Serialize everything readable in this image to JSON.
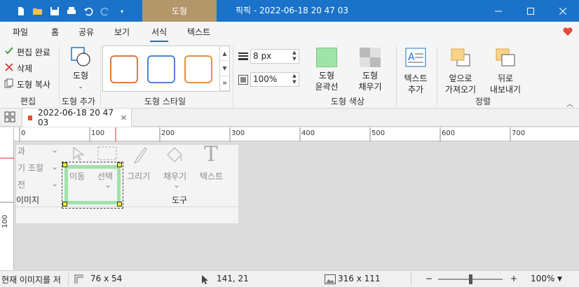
{
  "titlebar": {
    "context_tab": "도형",
    "title": "픽픽 - 2022-06-18 20 47 03",
    "accent": "#1a73c9"
  },
  "ribbon_tabs": [
    "파일",
    "홈",
    "공유",
    "보기",
    "서식",
    "텍스트"
  ],
  "active_tab": "서식",
  "edit_group": {
    "done": "편집 완료",
    "delete": "삭제",
    "copy_shape": "도형 복사",
    "label": "편집"
  },
  "shape_add": {
    "button": "도형",
    "label": "도형 추가"
  },
  "shape_style": {
    "label": "도형 스타일",
    "colors": [
      "#e07a3c",
      "#4a86d0",
      "#e8913c"
    ]
  },
  "line_props": {
    "width": "8 px",
    "opacity": "100%"
  },
  "shape_color": {
    "outline_l1": "도형",
    "outline_l2": "윤곽선",
    "fill_l1": "도형",
    "fill_l2": "채우기",
    "label": "도형 색상",
    "outline_color": "#9ee3a8"
  },
  "text_add": {
    "l1": "텍스트",
    "l2": "추가"
  },
  "arrange": {
    "front_l1": "앞으로",
    "front_l2": "가져오기",
    "back_l1": "뒤로",
    "back_l2": "내보내기",
    "label": "정렬"
  },
  "document_tab": {
    "name": "2022-06-18 20 47 03"
  },
  "ruler": {
    "h_ticks": [
      "0",
      "100",
      "200",
      "300",
      "400",
      "500",
      "600",
      "700"
    ],
    "v_ticks": [
      "100"
    ]
  },
  "image_content": {
    "line1": "과",
    "line2": "기 조절",
    "line3": "전",
    "label_image": "이미지",
    "move": "이동",
    "select": "선택",
    "draw": "그리기",
    "fill": "채우기",
    "text": "텍스트",
    "tools": "도구"
  },
  "statusbar": {
    "status_text": "현재 이미지를 저",
    "selection_size": "76 x 54",
    "cursor": "141, 21",
    "image_size": "316 x 111",
    "zoom": "100%",
    "zoom_level": 0.5
  }
}
